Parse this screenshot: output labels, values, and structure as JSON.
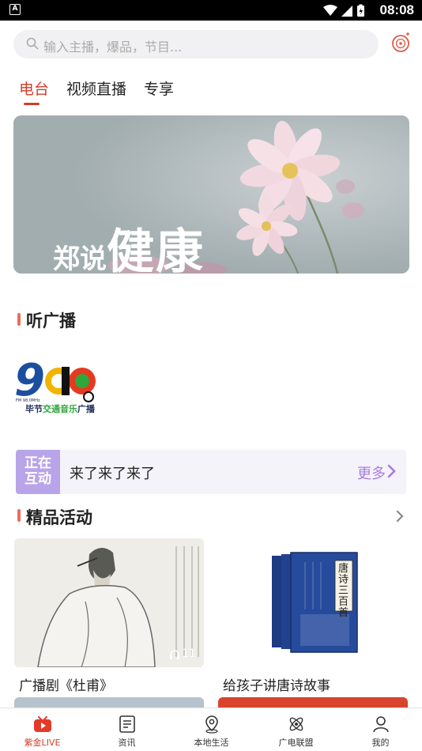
{
  "status_bar": {
    "time": "08:08"
  },
  "search": {
    "placeholder": "输入主播，爆品，节目..."
  },
  "tabs": [
    {
      "label": "电台",
      "active": true
    },
    {
      "label": "视频直播",
      "active": false
    },
    {
      "label": "专享",
      "active": false
    }
  ],
  "banner": {
    "text_small": "郑说",
    "text_big": "健康"
  },
  "section_radio": {
    "title": "听广播"
  },
  "radio_station": {
    "number": "980",
    "freq": "FM 98.0MHz",
    "name_a": "毕节",
    "name_b": "交通音乐",
    "name_c": "广播"
  },
  "interaction": {
    "badge_line1": "正在",
    "badge_line2": "互动",
    "message": "来了来了来了",
    "more_label": "更多"
  },
  "section_activities": {
    "title": "精品活动"
  },
  "activities": [
    {
      "title": "广播剧《杜甫》",
      "listen_count": "11"
    },
    {
      "title": "给孩子讲唐诗故事",
      "book_title": "唐诗三百首"
    }
  ],
  "bottom_nav": [
    {
      "label": "紫金LIVE",
      "icon": "live-tv-icon",
      "active": true
    },
    {
      "label": "资讯",
      "icon": "news-list-icon",
      "active": false
    },
    {
      "label": "本地生活",
      "icon": "map-pin-icon",
      "active": false
    },
    {
      "label": "广电联盟",
      "icon": "atom-icon",
      "active": false
    },
    {
      "label": "我的",
      "icon": "user-icon",
      "active": false
    }
  ],
  "colors": {
    "accent": "#d33b2a",
    "section_bar": "#ee6b5a",
    "interact_badge": "#b9a4ea",
    "more_link": "#a77de0"
  }
}
